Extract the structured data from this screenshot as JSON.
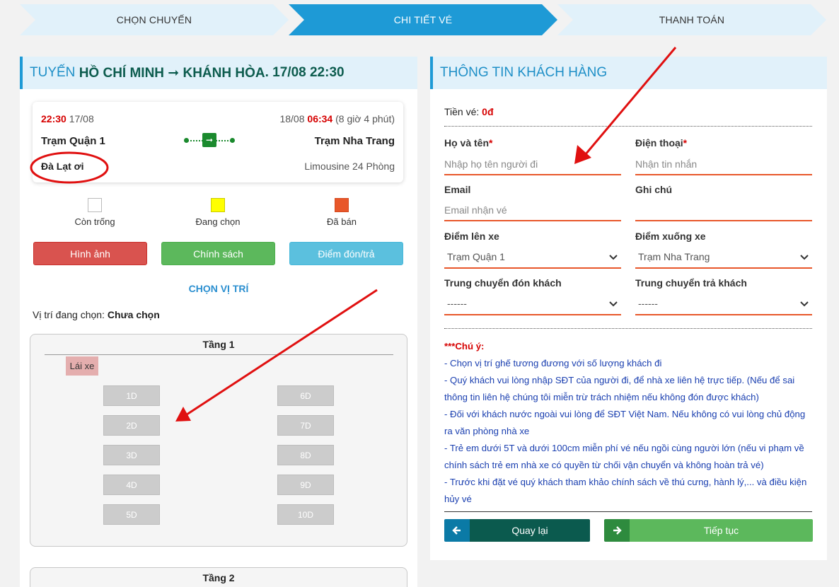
{
  "steps": [
    "CHỌN CHUYẾN",
    "CHI TIẾT VÉ",
    "THANH TOÁN"
  ],
  "route_header": {
    "prefix": "TUYẾN",
    "route": "HỒ CHÍ MINH ➞ KHÁNH HÒA",
    "datetime": ". 17/08 22:30"
  },
  "trip": {
    "depart_time": "22:30",
    "depart_date": "17/08",
    "arrive_date": "18/08",
    "arrive_time": "06:34",
    "duration": "(8 giờ 4 phút)",
    "from_station": "Trạm Quận 1",
    "to_station": "Trạm Nha Trang",
    "operator": "Đà Lạt ơi",
    "vehicle": "Limousine 24 Phòng"
  },
  "legend": [
    {
      "label": "Còn trống",
      "color": "#ffffff"
    },
    {
      "label": "Đang chọn",
      "color": "#ffff00"
    },
    {
      "label": "Đã bán",
      "color": "#e8572a"
    }
  ],
  "buttons": {
    "images": "Hình ảnh",
    "policy": "Chính sách",
    "pickup": "Điểm đón/trả",
    "back": "Quay lại",
    "next": "Tiếp tục"
  },
  "seat_section": {
    "title": "CHỌN VỊ TRÍ",
    "selected_label": "Vị trí đang chọn:",
    "selected_value": "Chưa chọn",
    "floor1": "Tầng 1",
    "floor2": "Tầng 2",
    "driver": "Lái xe",
    "seats_left": [
      "1D",
      "2D",
      "3D",
      "4D",
      "5D"
    ],
    "seats_right": [
      "6D",
      "7D",
      "8D",
      "9D",
      "10D"
    ]
  },
  "customer": {
    "header": "THÔNG TIN KHÁCH HÀNG",
    "price_label": "Tiền vé:",
    "price_value": "0đ",
    "name_label": "Họ và tên",
    "name_placeholder": "Nhập họ tên người đi",
    "phone_label": "Điện thoại",
    "phone_placeholder": "Nhận tin nhắn",
    "email_label": "Email",
    "email_placeholder": "Email nhận vé",
    "note_label": "Ghi chú",
    "pickup_label": "Điểm lên xe",
    "pickup_value": "Trạm Quận 1",
    "dropoff_label": "Điểm xuống xe",
    "dropoff_value": "Trạm Nha Trang",
    "transfer_pick_label": "Trung chuyển đón khách",
    "transfer_pick_value": "------",
    "transfer_drop_label": "Trung chuyển trả khách",
    "transfer_drop_value": "------",
    "required_mark": "*"
  },
  "notes": {
    "title": "***Chú ý:",
    "lines": [
      "- Chọn vị trí ghế tương đương với số lượng khách đi",
      "- Quý khách vui lòng nhập SĐT của người đi, để nhà xe liên hệ trực tiếp. (Nếu để sai thông tin liên hệ chúng tôi miễn trừ trách nhiệm nếu không đón được khách)",
      "- Đối với khách nước ngoài vui lòng để SĐT Việt Nam. Nếu không có vui lòng chủ động ra văn phòng nhà xe",
      "- Trẻ em dưới 5T và dưới 100cm miễn phí vé nếu ngồi cùng người lớn (nếu vi phạm về chính sách trẻ em nhà xe có quyền từ chối vận chuyển và không hoàn trả vé)",
      "- Trước khi đặt vé quý khách tham khảo chính sách về thú cưng, hành lý,... và điều kiện hủy vé"
    ]
  },
  "colors": {
    "accent": "#1e9ad6",
    "danger": "#d9534f",
    "success": "#5cb85c",
    "info": "#5bc0de",
    "back_btn": "#0b5a4e",
    "next_btn": "#5cb85c"
  }
}
